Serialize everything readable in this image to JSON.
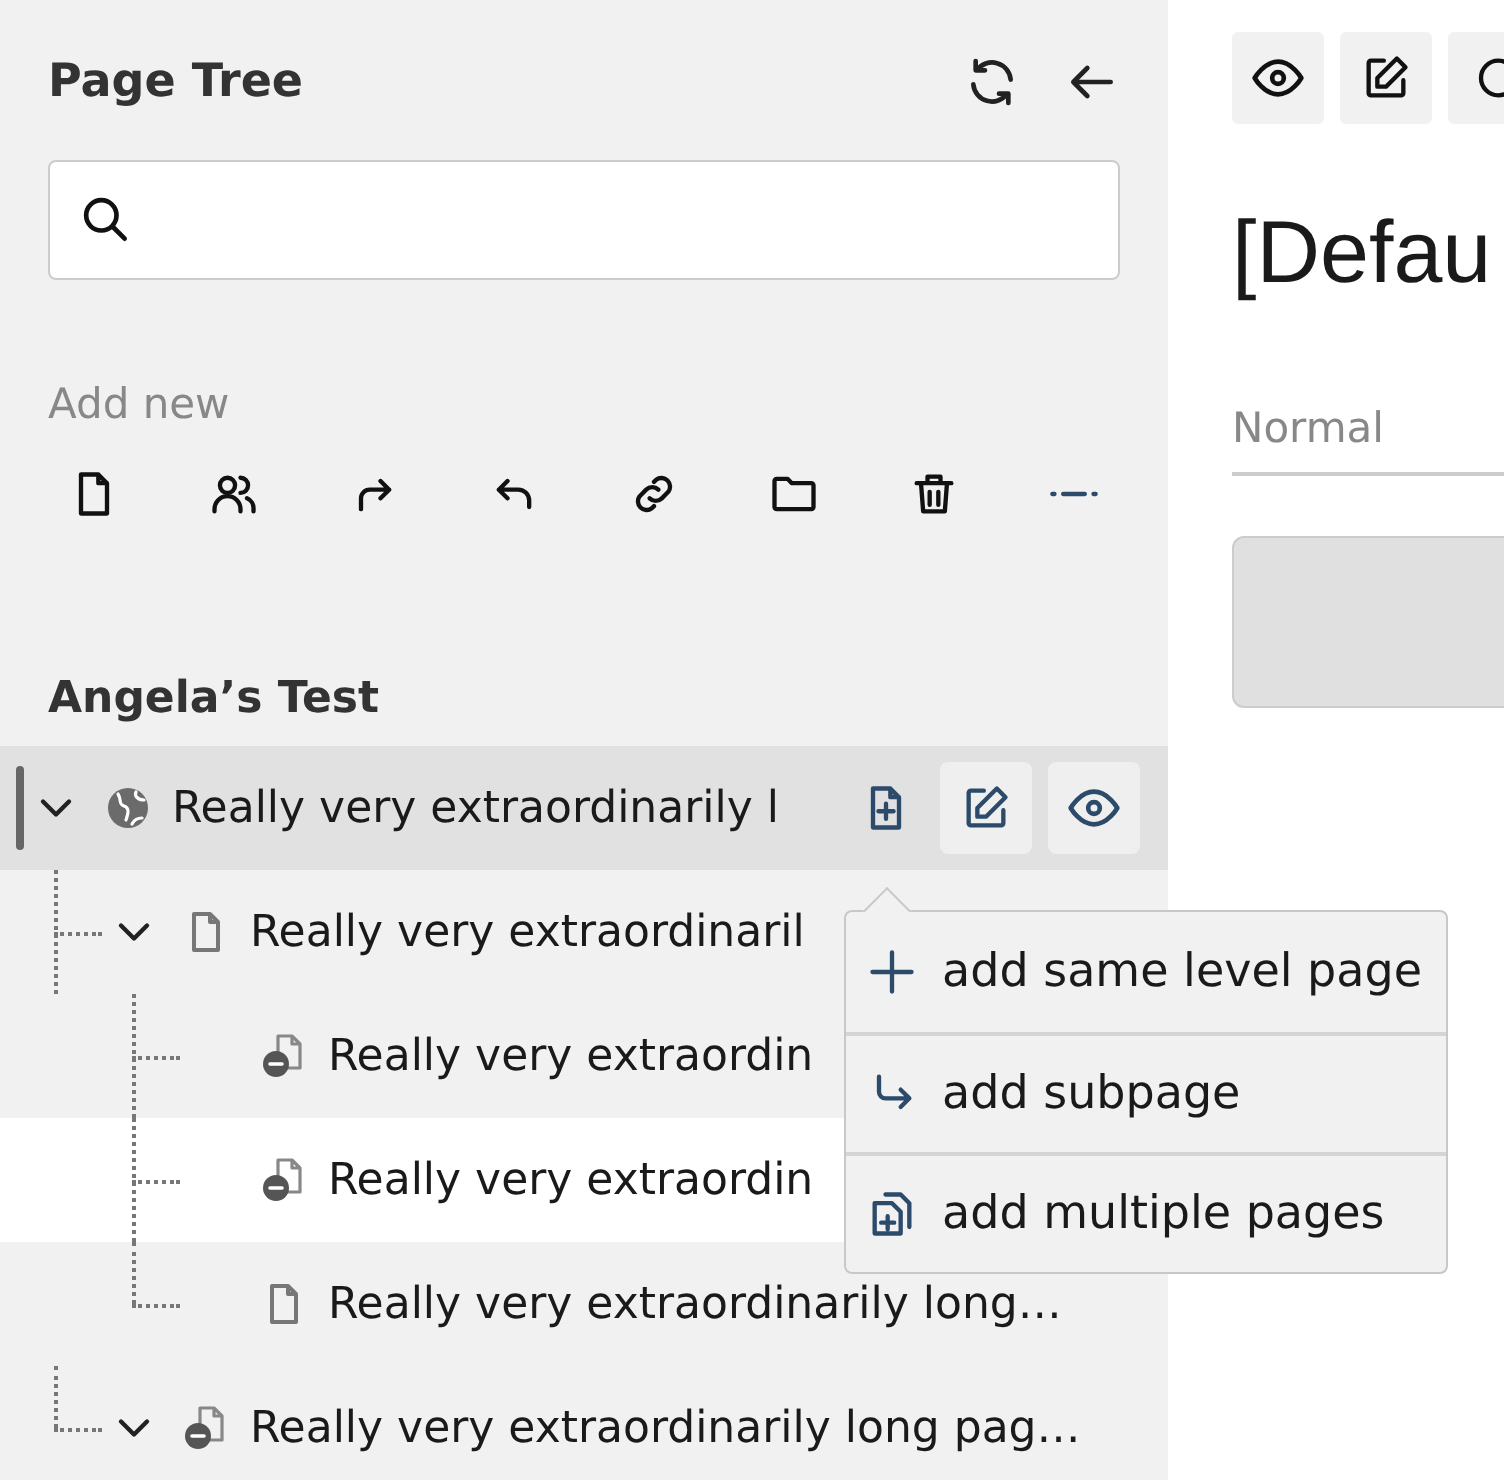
{
  "header": {
    "title": "Page Tree"
  },
  "add_new": {
    "label": "Add new"
  },
  "site": {
    "title": "Angela’s Test"
  },
  "tree": [
    {
      "label": "Really very extraordinarily l",
      "kind": "globe",
      "expanded": true,
      "selected": true,
      "highlighted": false,
      "children": [
        {
          "label": "Really very extraordinaril",
          "kind": "page",
          "expanded": true,
          "selected": false,
          "highlighted": false,
          "children": [
            {
              "label": "Really very extraordin",
              "kind": "hidden",
              "selected": false,
              "highlighted": false
            },
            {
              "label": "Really very extraordin",
              "kind": "hidden",
              "selected": false,
              "highlighted": true
            },
            {
              "label": "Really very extraordinarily long…",
              "kind": "page",
              "selected": false,
              "highlighted": false
            }
          ]
        },
        {
          "label": "Really very extraordinarily long pag…",
          "kind": "hidden",
          "expanded": true,
          "selected": false,
          "highlighted": false
        }
      ]
    }
  ],
  "popover": {
    "items": [
      {
        "label": "add same level page",
        "kind": "plus"
      },
      {
        "label": "add subpage",
        "kind": "subpage"
      },
      {
        "label": "add multiple pages",
        "kind": "multiple"
      }
    ]
  },
  "editor": {
    "title": "[Defau",
    "field": {
      "placeholder": "Normal"
    }
  }
}
